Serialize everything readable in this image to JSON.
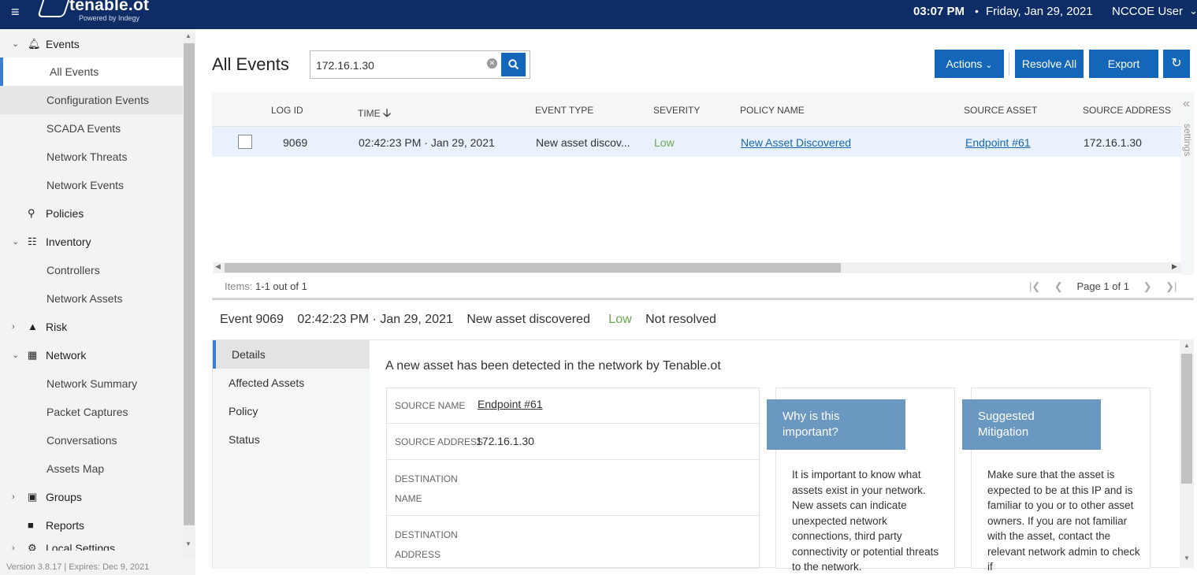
{
  "header": {
    "logo_text": "tenable.ot",
    "logo_sub": "Powered by Indegy",
    "time": "03:07 PM",
    "separator": "•",
    "date": "Friday, Jan 29, 2021",
    "user": "NCCOE User"
  },
  "sidebar": {
    "items": [
      {
        "label": "Events",
        "icon": "bell-icon",
        "expanded": true
      },
      {
        "label": "All Events",
        "active": true
      },
      {
        "label": "Configuration Events"
      },
      {
        "label": "SCADA Events"
      },
      {
        "label": "Network Threats"
      },
      {
        "label": "Network Events"
      },
      {
        "label": "Policies",
        "icon": "policy-icon"
      },
      {
        "label": "Inventory",
        "icon": "inventory-icon",
        "expanded": true
      },
      {
        "label": "Controllers"
      },
      {
        "label": "Network Assets"
      },
      {
        "label": "Risk",
        "icon": "risk-icon",
        "expanded": false
      },
      {
        "label": "Network",
        "icon": "network-icon",
        "expanded": true
      },
      {
        "label": "Network Summary"
      },
      {
        "label": "Packet Captures"
      },
      {
        "label": "Conversations"
      },
      {
        "label": "Assets Map"
      },
      {
        "label": "Groups",
        "icon": "groups-icon",
        "expanded": false
      },
      {
        "label": "Reports",
        "icon": "reports-icon"
      },
      {
        "label": "Local Settings",
        "icon": "settings-icon"
      }
    ],
    "version": "Version 3.8.17 | Expires: Dec 9, 2021"
  },
  "main": {
    "title": "All Events",
    "search_value": "172.16.1.30",
    "actions_label": "Actions",
    "resolve_all_label": "Resolve All",
    "export_label": "Export"
  },
  "grid": {
    "columns": [
      "LOG ID",
      "TIME",
      "EVENT TYPE",
      "SEVERITY",
      "POLICY NAME",
      "SOURCE ASSET",
      "SOURCE ADDRESS"
    ],
    "rows": [
      {
        "log_id": "9069",
        "time": "02:42:23 PM · Jan 29, 2021",
        "event_type": "New asset discov...",
        "severity": "Low",
        "policy_name": "New Asset Discovered",
        "source_asset": "Endpoint #61",
        "source_address": "172.16.1.30"
      }
    ],
    "settings_label": "settings",
    "items_label": "Items:",
    "items_value": "1-1 out of 1",
    "page_label": "Page 1 of 1"
  },
  "detail": {
    "event_id": "Event 9069",
    "time": "02:42:23 PM · Jan 29, 2021",
    "type": "New asset discovered",
    "severity": "Low",
    "status": "Not resolved",
    "tabs": [
      "Details",
      "Affected Assets",
      "Policy",
      "Status"
    ],
    "description": "A new asset has been detected in the network by Tenable.ot",
    "fields": {
      "source_name_key": "SOURCE NAME",
      "source_name_val": "Endpoint #61",
      "source_address_key": "SOURCE ADDRESS",
      "source_address_val": "172.16.1.30",
      "dest_name_key_1": "DESTINATION",
      "dest_name_key_2": "NAME",
      "dest_address_key_1": "DESTINATION",
      "dest_address_key_2": "ADDRESS"
    },
    "why_title_1": "Why is this",
    "why_title_2": "important?",
    "why_text": "It is important to know what assets exist in your network. New assets can indicate unexpected network connections, third party connectivity or potential threats to the network.",
    "mitigation_title_1": "Suggested",
    "mitigation_title_2": "Mitigation",
    "mitigation_text": "Make sure that the asset is expected to be at this IP and is familiar to you or to other asset owners. If you are not familiar with the asset, contact the relevant network admin to check if"
  },
  "colors": {
    "topbar": "#0e2c66",
    "primary": "#1466b8",
    "low": "#6aa84f",
    "card_head": "#6a98c0"
  }
}
